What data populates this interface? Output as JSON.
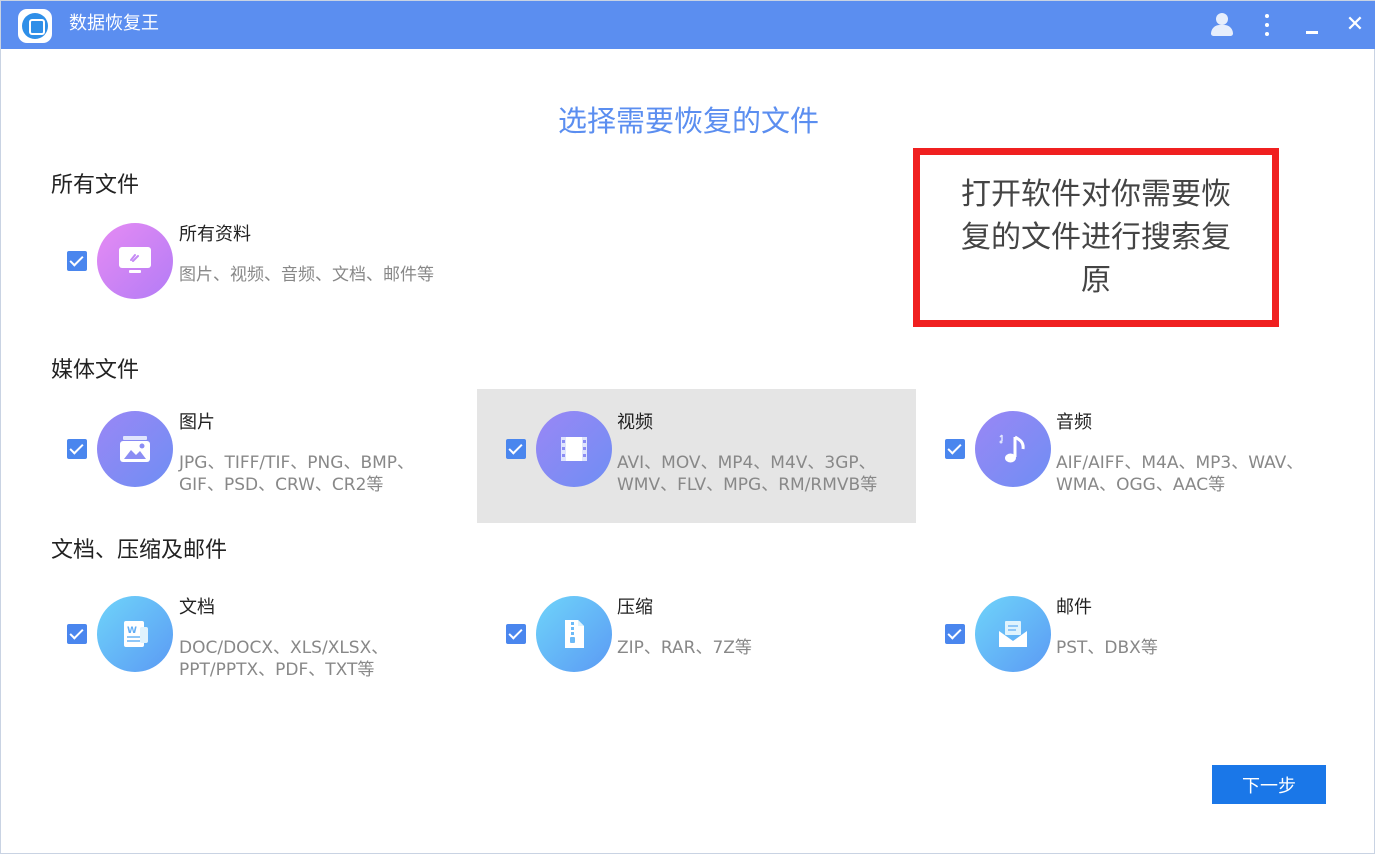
{
  "window": {
    "title": "数据恢复王",
    "controls": {
      "minimize": "—",
      "close": "✕"
    }
  },
  "page": {
    "heading": "选择需要恢复的文件"
  },
  "sections": {
    "all": {
      "title": "所有文件",
      "items": [
        {
          "name": "所有资料",
          "desc": "图片、视频、音频、文档、邮件等",
          "checked": true,
          "icon": "monitor-icon"
        }
      ]
    },
    "media": {
      "title": "媒体文件",
      "items": [
        {
          "name": "图片",
          "desc": "JPG、TIFF/TIF、PNG、BMP、GIF、PSD、CRW、CR2等",
          "checked": true,
          "icon": "picture-icon"
        },
        {
          "name": "视频",
          "desc": "AVI、MOV、MP4、M4V、3GP、WMV、FLV、MPG、RM/RMVB等",
          "checked": true,
          "icon": "film-icon"
        },
        {
          "name": "音频",
          "desc": "AIF/AIFF、M4A、MP3、WAV、WMA、OGG、AAC等",
          "checked": true,
          "icon": "music-note-icon"
        }
      ]
    },
    "docs": {
      "title": "文档、压缩及邮件",
      "items": [
        {
          "name": "文档",
          "desc": "DOC/DOCX、XLS/XLSX、PPT/PPTX、PDF、TXT等",
          "checked": true,
          "icon": "word-document-icon"
        },
        {
          "name": "压缩",
          "desc": "ZIP、RAR、7Z等",
          "checked": true,
          "icon": "zip-file-icon"
        },
        {
          "name": "邮件",
          "desc": "PST、DBX等",
          "checked": true,
          "icon": "mail-icon"
        }
      ]
    }
  },
  "annotation": {
    "text": "打开软件对你需要恢复的文件进行搜索复原",
    "border_color": "#f02020"
  },
  "footer": {
    "next_label": "下一步"
  },
  "colors": {
    "titlebar": "#5b8ef0",
    "heading": "#5b8ef0",
    "checkbox": "#4a86ee",
    "button": "#1a77e8",
    "highlight": "#e5e5e5"
  }
}
